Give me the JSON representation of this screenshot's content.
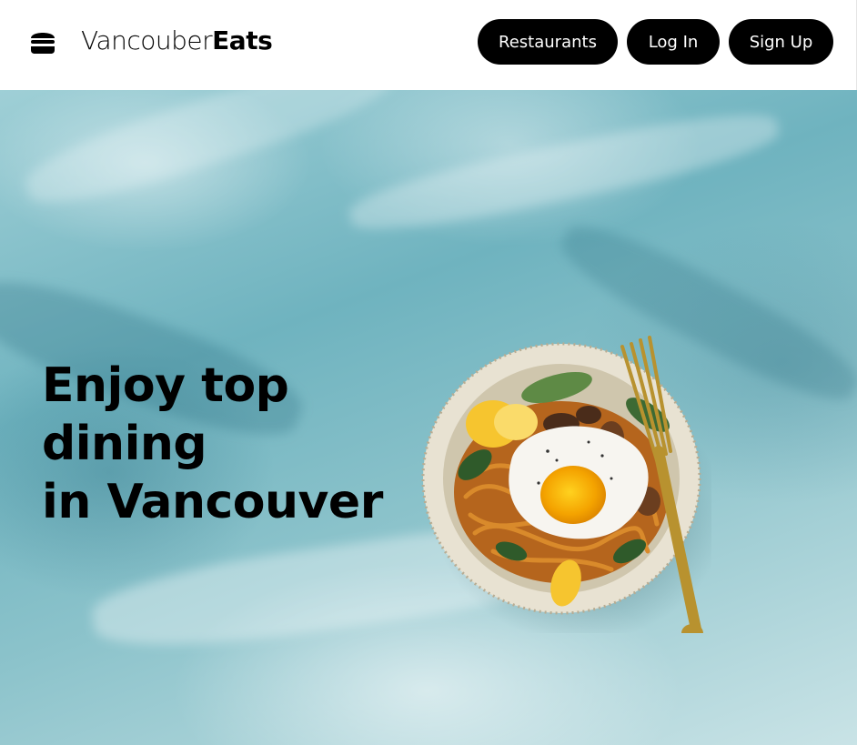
{
  "navbar": {
    "logo_icon": "burger-icon",
    "brand_prefix": "Vancouber",
    "brand_suffix": "Eats",
    "buttons": {
      "restaurants": "Restaurants",
      "login": "Log In",
      "signup": "Sign Up"
    }
  },
  "hero": {
    "headline_line1": "Enjoy top dining",
    "headline_line2": "in Vancouver",
    "image": "food-bowl-photo"
  },
  "colors": {
    "button_bg": "#000000",
    "button_text": "#ffffff",
    "hero_bg": "#7fbcc6"
  }
}
